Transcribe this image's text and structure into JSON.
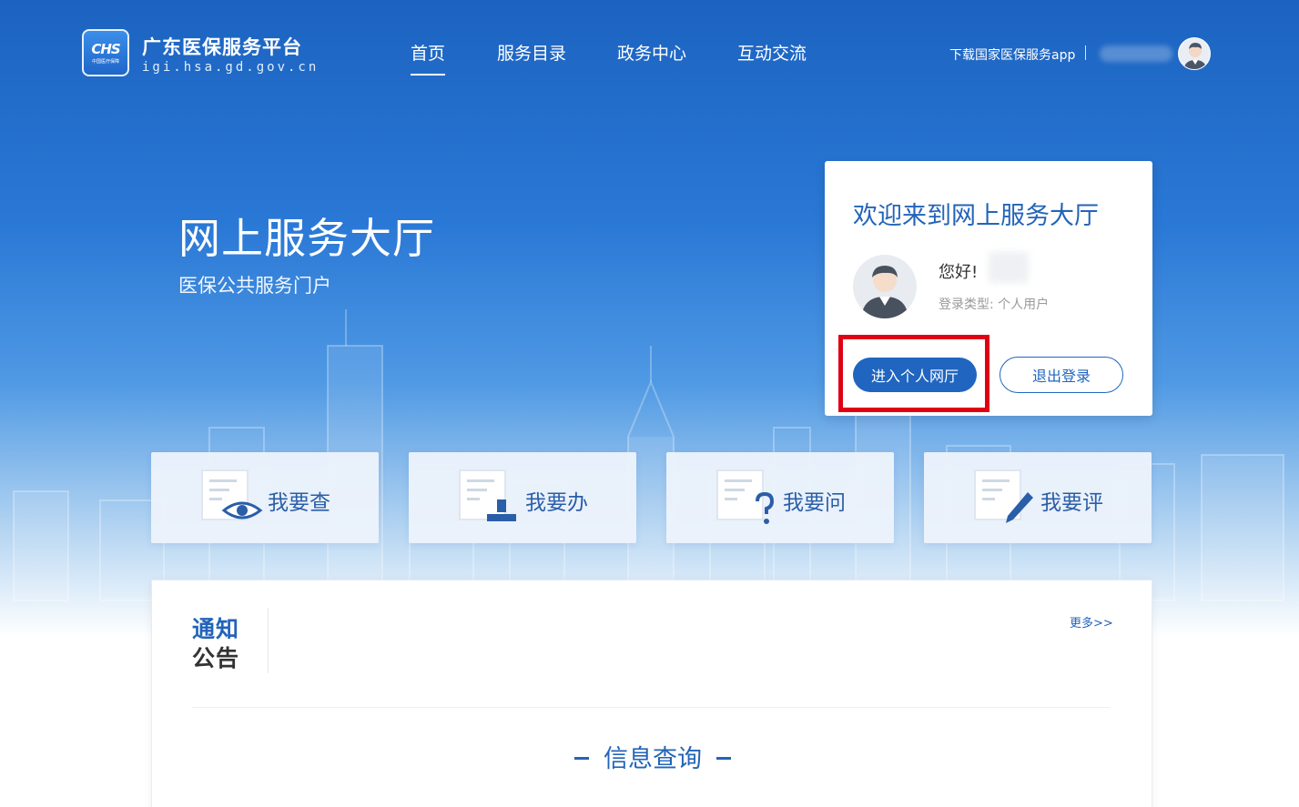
{
  "header": {
    "site_name": "广东医保服务平台",
    "site_domain": "igi.hsa.gd.gov.cn",
    "logo_text": "CHS",
    "logo_sub": "中国医疗保障",
    "nav": [
      {
        "label": "首页",
        "active": true
      },
      {
        "label": "服务目录",
        "active": false
      },
      {
        "label": "政务中心",
        "active": false
      },
      {
        "label": "互动交流",
        "active": false
      }
    ],
    "download_link": "下载国家医保服务app"
  },
  "hero": {
    "title": "网上服务大厅",
    "subtitle": "医保公共服务门户"
  },
  "welcome_card": {
    "title": "欢迎来到网上服务大厅",
    "greeting": "您好!",
    "login_type": "登录类型: 个人用户",
    "enter_button": "进入个人网厅",
    "logout_button": "退出登录"
  },
  "services": [
    {
      "label": "我要查",
      "icon": "doc-eye-icon"
    },
    {
      "label": "我要办",
      "icon": "doc-stamp-icon"
    },
    {
      "label": "我要问",
      "icon": "doc-question-icon"
    },
    {
      "label": "我要评",
      "icon": "doc-pen-icon"
    }
  ],
  "notice": {
    "title_line1": "通知",
    "title_line2": "公告",
    "more": "更多>>"
  },
  "info_query": {
    "title": "信息查询"
  },
  "colors": {
    "primary": "#2065bf",
    "highlight": "#e00014"
  }
}
